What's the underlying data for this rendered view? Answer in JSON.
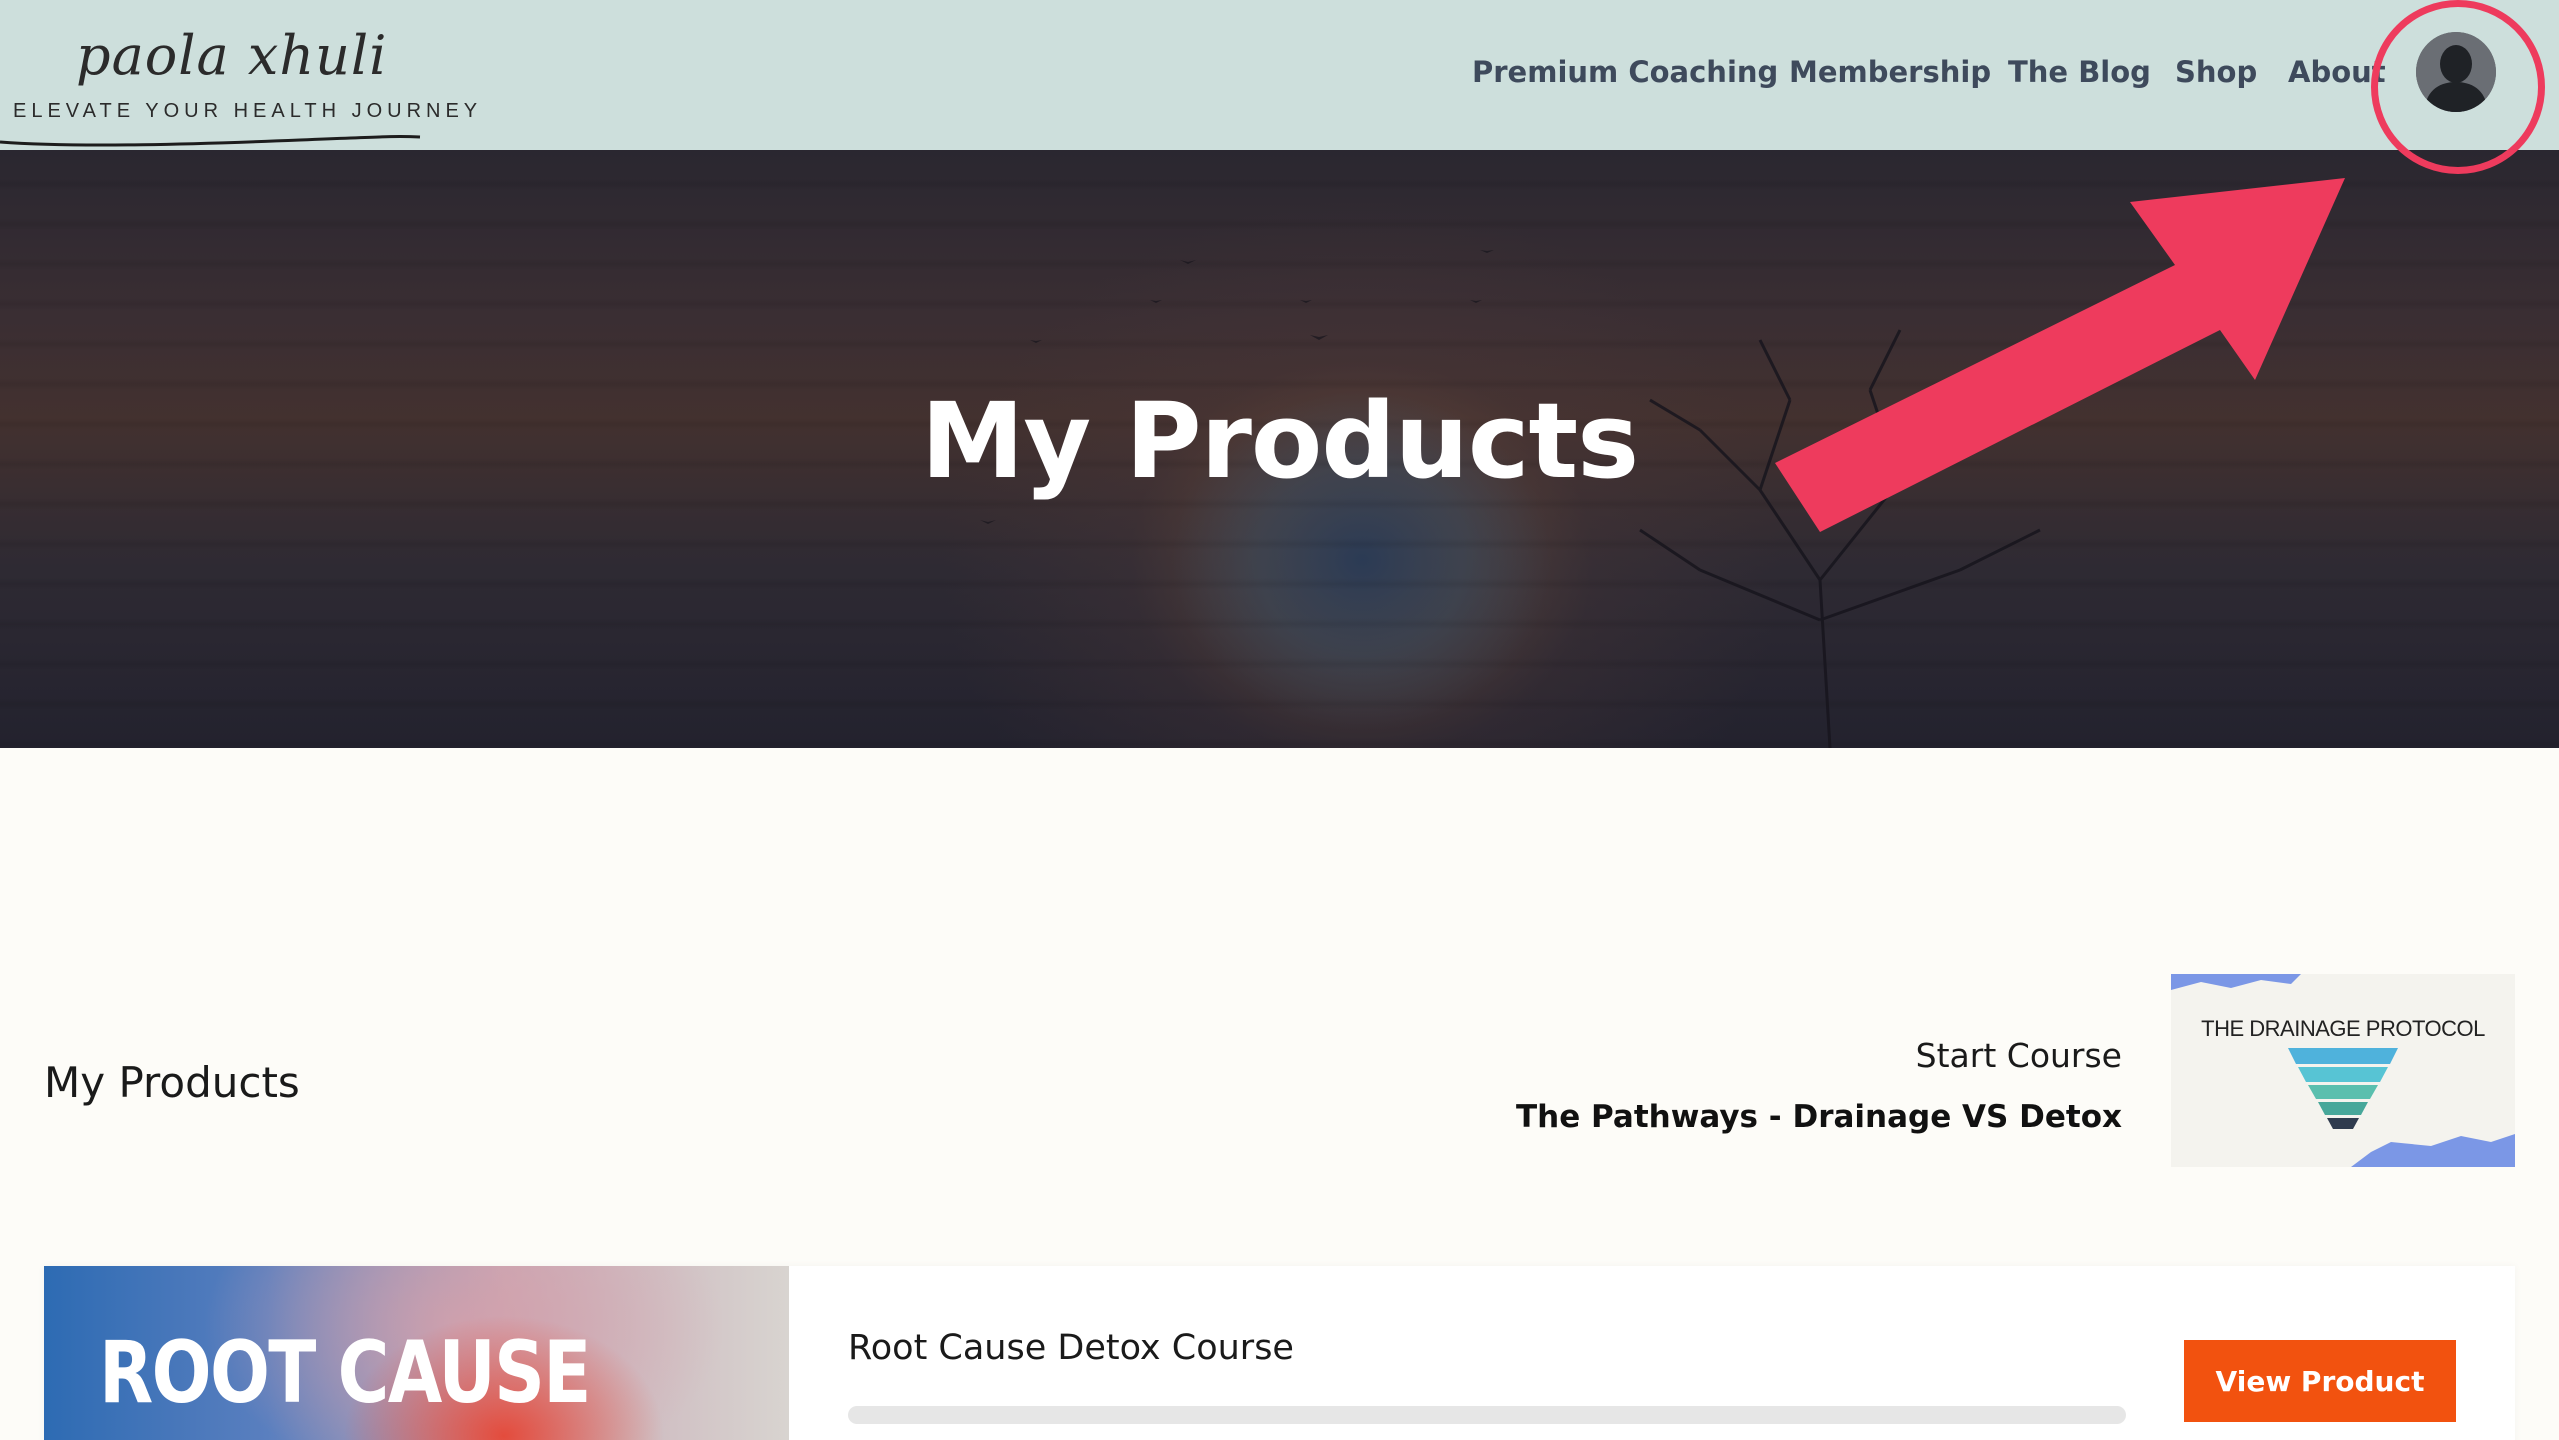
{
  "header": {
    "logo": {
      "name": "paola xhuli",
      "tagline": "ELEVATE YOUR HEALTH JOURNEY"
    },
    "nav": [
      {
        "label": "Premium Coaching"
      },
      {
        "label": "Membership"
      },
      {
        "label": "The Blog"
      },
      {
        "label": "Shop"
      },
      {
        "label": "About"
      }
    ],
    "account_icon": "user-avatar-icon"
  },
  "hero": {
    "title": "My Products"
  },
  "annotation": {
    "color": "#ee3b5d",
    "target": "account-avatar"
  },
  "products_section": {
    "title": "My Products",
    "resume": {
      "kicker": "Start Course",
      "course_title": "The Pathways - Drainage VS Detox",
      "thumbnail_title": "THE DRAINAGE PROTOCOL"
    },
    "products": [
      {
        "title": "Root Cause Detox Course",
        "thumbnail_text": "ROOT CAUSE",
        "progress": 0,
        "button_label": "View Product"
      }
    ]
  },
  "colors": {
    "header_bg": "#cddfdc",
    "nav_text": "#3e4a5c",
    "button_bg": "#f2520f",
    "page_bg": "#fdfcf8"
  }
}
